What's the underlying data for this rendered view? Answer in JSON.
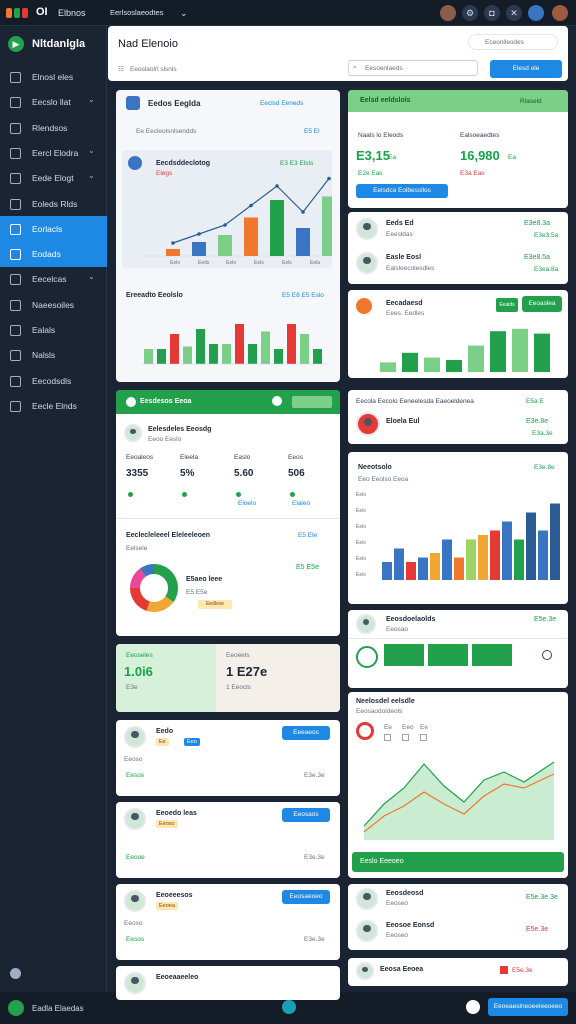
{
  "topbar": {
    "brand": "OI",
    "app": "Elbnos",
    "workspace": "Eerlsoslaeodtes"
  },
  "sidebar": {
    "brand": "Nltdanlgla",
    "items": [
      {
        "label": "Elnosl eles",
        "chev": false
      },
      {
        "label": "Eecslo llat",
        "chev": true
      },
      {
        "label": "Rlendsos",
        "chev": false
      },
      {
        "label": "Eercl Elodra",
        "chev": true
      },
      {
        "label": "Eede Elogt",
        "chev": true
      },
      {
        "label": "Eoleds Rlds",
        "chev": false
      },
      {
        "label": "Eorlacls",
        "chev": false,
        "active": true
      },
      {
        "label": "Eodads",
        "chev": false,
        "active": true
      },
      {
        "label": "Eecelcas",
        "chev": true
      },
      {
        "label": "Naeesoiles",
        "chev": false
      },
      {
        "label": "Ealals",
        "chev": false
      },
      {
        "label": "Nalsls",
        "chev": false
      },
      {
        "label": "Eecodsdls",
        "chev": false
      },
      {
        "label": "Eecle Elnds",
        "chev": false
      }
    ],
    "footer": "Eadla Elaedas"
  },
  "header": {
    "title": "Nad Elenoio",
    "subtitle": "Eeoslaolrl slsnls",
    "right_label": "Eceonlleodes",
    "search_placeholder": "Eesoenlaeds",
    "button": "Elesd ele"
  },
  "card_a": {
    "title": "Eedos Eeglda",
    "link": "Eeclsd Eeneds",
    "sub": "Ee Eecleolsnlsendds",
    "sub_right": "E5 El",
    "inner_title": "Eecdsddeclotog",
    "inner_sub": "Elegs",
    "inner_value": "E3 E3 Elsls",
    "ticks": [
      "Eelo",
      "Eeds",
      "Eelo",
      "Eels",
      "Eels",
      "Eela"
    ],
    "bottom_title": "Ereeadto Eeolslo",
    "bottom_value": "E5 E8 E5 Eslo"
  },
  "card_b": {
    "header": "Eelsd eeldslols",
    "header_right": "Rlaseld",
    "left_label": "Naals lo Eleods",
    "right_label": "Ealsoeaedtes",
    "left_value": "E3,15",
    "left_delta": "Ea",
    "right_value": "16,980",
    "right_delta": "Ea",
    "left_sub": "E2e Eas",
    "right_sub": "E3a Eas",
    "button": "Eelsdca Eolbessllos"
  },
  "people_a": [
    {
      "name": "Eeds Ed",
      "role": "Eeesldas",
      "amount": "E3e8.3a",
      "sub": "E3e3.5a"
    },
    {
      "name": "Easle Eosl",
      "role": "Ealsleecolesdles",
      "amount": "E3e8.5a",
      "sub": "E3ea.8a"
    }
  ],
  "card_c": {
    "title": "Eecadaesd",
    "subtitle": "Eees. Eedles",
    "btn": "Eeoaslea",
    "chip": "Eealds"
  },
  "card_d": {
    "header": "Eesdesos Eeoa",
    "profile_name": "Eelesdeles Eeosdg",
    "profile_sub": "Eeoo Eeslo",
    "labels": [
      "Eeoaleos",
      "Eleela",
      "Easlo",
      "Eeos"
    ],
    "values": [
      "3355",
      "5%",
      "5.60",
      "506"
    ],
    "subs": [
      "",
      "",
      "Eloelo",
      "Elaleo"
    ],
    "section": "Eeclecleleeel Eleleeleoen",
    "section_right": "E5 Ele",
    "section_sub": "Eelsele",
    "donut_label": "E5aeo leee",
    "donut_value": "E5 E5e",
    "donut_chip": "Eedlsoe",
    "donut_pct": "E5 E5e"
  },
  "card_e": {
    "title": "Eecola Eecolo Eeneelesda Eaeoeldenea",
    "title_right": "E5a E",
    "name": "Eloela Eul",
    "value": "E3e.8e",
    "sub": "E3a.3e"
  },
  "card_f": {
    "title": "Neeotsolo",
    "sub": "Eeo Eeolso Eeoa",
    "value": "E3e.8e",
    "ticks": [
      "Eelo",
      "Eels",
      "Eelo",
      "Eels",
      "Eelo",
      "Eels"
    ]
  },
  "card_g": {
    "name": "Eeosdoelaolds",
    "role": "Eeosao",
    "amount": "E5e.3e"
  },
  "card_h": {
    "title": "Neelosdel eelsdle",
    "sub": "Eeosaodoldeols",
    "legend": [
      "Ee",
      "Eeo",
      "Ee"
    ],
    "button": "Eeslo Eeeoeo"
  },
  "stats": {
    "left_label": "Eeoseles",
    "left_value": "1.0i6",
    "left_sub": "E3e",
    "right_label": "Eeoeels",
    "right_value": "1 E27e",
    "right_sub": "1 Eeocls"
  },
  "list": [
    {
      "name": "Eedo",
      "tags": [
        "Ee",
        "Eeo"
      ],
      "label": "Eeoso",
      "amount": "E3e.3e",
      "sub": "Eesos",
      "button": "Eeeaeos"
    },
    {
      "name": "Eeoedo leas",
      "tags": [
        "Eeoso"
      ],
      "label": "",
      "amount": "E3e.3e",
      "sub": "Eeooe",
      "button": "Eeosaos"
    },
    {
      "name": "Eeoeeesos",
      "tags": [
        "Eeoea"
      ],
      "label": "Eeoso",
      "amount": "E3e.3e",
      "sub": "Eesos",
      "button": "Eeosaeoeo"
    },
    {
      "name": "Eeoeaaeeleo",
      "tags": [],
      "label": "",
      "amount": "",
      "sub": "",
      "button": ""
    }
  ],
  "people_b": [
    {
      "name": "Eeosdeosd",
      "role": "Eeoseo",
      "amount": "E5e.3e.3e"
    },
    {
      "name": "Eeosoe Eonsd",
      "role": "Eeoseo",
      "amount": "E5e.3e"
    }
  ],
  "bottom": {
    "name": "Eeosa Eeoea",
    "amount": "E5e.3e",
    "button": "Eeoeaeslneoeeleeoeeo"
  },
  "colors": {
    "accent": "#1e88e5",
    "green": "#22a04b",
    "light_green": "#7ccf87",
    "sidebar": "#1b2433",
    "orange": "#f0782d",
    "navy": "#2b5c94"
  },
  "chart_a_values": [
    {
      "x": 0,
      "v": 0.1,
      "c": "#f0782d"
    },
    {
      "x": 1,
      "v": 0.2,
      "c": "#3a75c4"
    },
    {
      "x": 2,
      "v": 0.3,
      "c": "#7ccf87"
    },
    {
      "x": 3,
      "v": 0.55,
      "c": "#f0782d"
    },
    {
      "x": 4,
      "v": 0.8,
      "c": "#22a04b"
    },
    {
      "x": 5,
      "v": 0.4,
      "c": "#3a75c4"
    },
    {
      "x": 6,
      "v": 0.85,
      "c": "#7ccf87"
    }
  ]
}
